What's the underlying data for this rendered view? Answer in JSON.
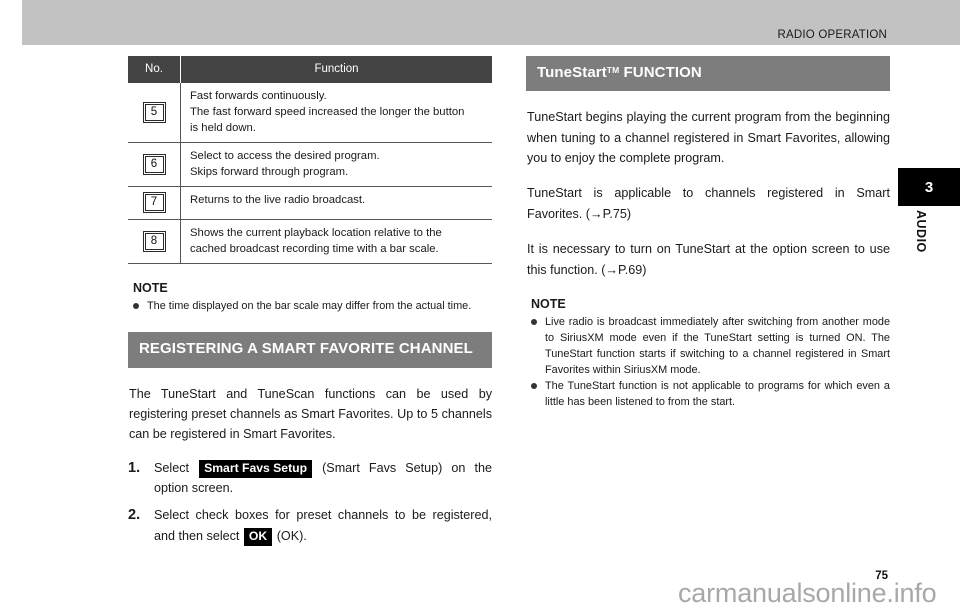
{
  "header": {
    "running_title": "RADIO OPERATION"
  },
  "chapter_tab": {
    "number": "3",
    "name": "AUDIO"
  },
  "footer": {
    "page_number": "75",
    "watermark": "carmanualsonline.info"
  },
  "left_column": {
    "function_table": {
      "columns": [
        "No.",
        "Function"
      ],
      "rows": [
        {
          "no": "5",
          "lines": [
            "Fast forwards continuously.",
            "The fast forward speed increased the longer the button",
            "is held down."
          ]
        },
        {
          "no": "6",
          "lines": [
            "Select to access the desired program.",
            "Skips forward through program."
          ]
        },
        {
          "no": "7",
          "lines": [
            "Returns to the live radio broadcast."
          ]
        },
        {
          "no": "8",
          "lines": [
            "Shows the current playback location relative to the",
            "cached broadcast recording time with a bar scale."
          ]
        }
      ]
    },
    "note": {
      "title": "NOTE",
      "items": [
        "The time displayed on the bar scale may differ from the actual time."
      ]
    },
    "section_heading": "REGISTERING A SMART FAVORITE CHANNEL",
    "intro_paragraph": "The TuneStart and TuneScan functions can be used by registering preset channels as Smart Favorites. Up to 5 channels can be registered in Smart Favorites.",
    "steps": [
      {
        "number": "1.",
        "text_before": "Select",
        "key_label": "Smart Favs Setup",
        "text_after": "(Smart Favs Setup) on the option screen."
      },
      {
        "number": "2.",
        "text_before": "Select check boxes for preset channels to be registered, and then select",
        "key_label": "OK",
        "text_after": "(OK)."
      }
    ]
  },
  "right_column": {
    "section_heading_main": "TuneStart",
    "section_heading_sup": "TM",
    "section_heading_tail": " FUNCTION",
    "paragraphs": [
      "TuneStart begins playing the current program from the beginning when tuning to a channel registered in Smart Favorites, allowing you to enjoy the complete program.",
      "TuneStart is applicable to channels registered in Smart Favorites. (→P.75)",
      "It is necessary to turn on TuneStart at the option screen to use this function. (→P.69)"
    ],
    "note": {
      "title": "NOTE",
      "items": [
        "Live radio is broadcast immediately after switching from another mode to SiriusXM mode even if the TuneStart setting is turned ON. The TuneStart function starts if switching to a channel registered in Smart Favorites within SiriusXM mode.",
        "The TuneStart function is not applicable to programs for which even a little has been listened to from the start."
      ]
    }
  }
}
